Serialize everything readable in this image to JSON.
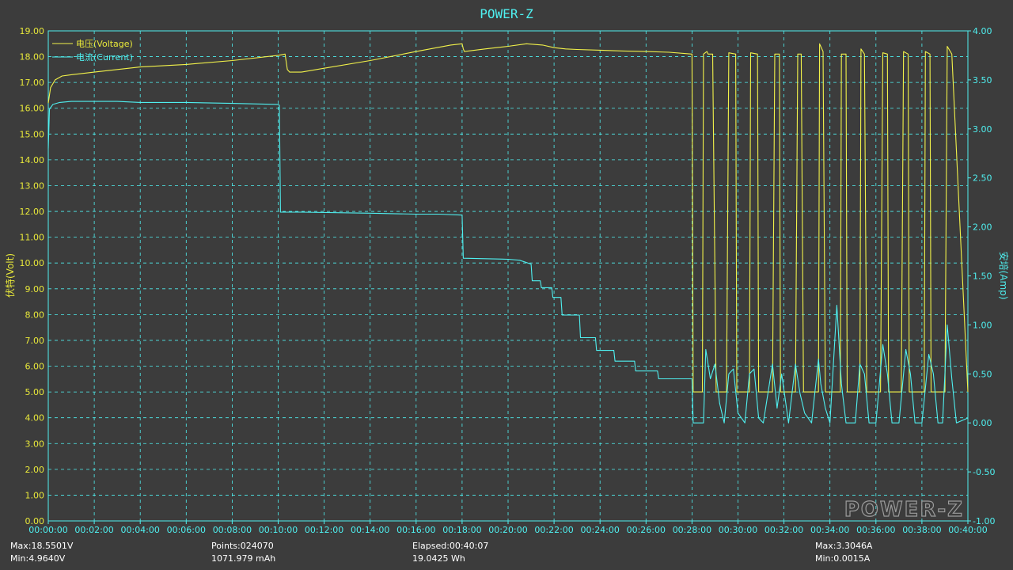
{
  "app": {
    "title": "POWER-Z",
    "logo_text": "POWER-Z"
  },
  "colors": {
    "background": "#3c3c3c",
    "plot_background": "#3c3c3c",
    "grid": "#4ff0f0",
    "voltage": "#f2f24a",
    "current": "#4ff0f0"
  },
  "stats": {
    "max_voltage": "Max:18.5501V",
    "min_voltage": "Min:4.9640V",
    "points": "Points:024070",
    "capacity": "1071.979 mAh",
    "elapsed": "Elapsed:00:40:07",
    "energy": "19.0425 Wh",
    "max_current": "Max:3.3046A",
    "min_current": "Min:0.0015A"
  },
  "chart_data": {
    "type": "line",
    "title": "POWER-Z",
    "x_unit": "elapsed time (minutes)",
    "xlim": [
      0,
      40
    ],
    "x_tick_labels": [
      "00:00:00",
      "00:02:00",
      "00:04:00",
      "00:06:00",
      "00:08:00",
      "00:10:00",
      "00:12:00",
      "00:14:00",
      "00:16:00",
      "00:18:00",
      "00:20:00",
      "00:22:00",
      "00:24:00",
      "00:26:00",
      "00:28:00",
      "00:30:00",
      "00:32:00",
      "00:34:00",
      "00:36:00",
      "00:38:00",
      "00:40:00"
    ],
    "ylabel": "伏特(Volt)",
    "ylim": [
      0,
      19
    ],
    "y_tick_labels": [
      "0.00",
      "1.00",
      "2.00",
      "3.00",
      "4.00",
      "5.00",
      "6.00",
      "7.00",
      "8.00",
      "9.00",
      "10.00",
      "11.00",
      "12.00",
      "13.00",
      "14.00",
      "15.00",
      "16.00",
      "17.00",
      "18.00",
      "19.00"
    ],
    "y2label": "安培(Amp)",
    "y2lim": [
      -1,
      4
    ],
    "y2_tick_labels": [
      "-1.00",
      "-0.50",
      "0.00",
      "0.50",
      "1.00",
      "1.50",
      "2.00",
      "2.50",
      "3.00",
      "3.50",
      "4.00"
    ],
    "grid": true,
    "legend_position": "top-left",
    "series": [
      {
        "name": "电压(Voltage)",
        "axis": "left",
        "x": [
          0,
          0.1,
          0.3,
          0.6,
          1.0,
          2.0,
          4.0,
          6.0,
          8.0,
          10.0,
          10.3,
          10.4,
          10.5,
          11.0,
          12.0,
          14.0,
          16.0,
          17.5,
          18.0,
          18.05,
          18.1,
          19.0,
          20.0,
          20.8,
          21.5,
          22.0,
          22.5,
          23.0,
          24.0,
          25.0,
          26.0,
          27.0,
          28.0,
          28.05,
          28.1,
          28.45,
          28.5,
          28.65,
          28.7,
          28.9,
          29.05,
          29.1,
          29.2,
          29.5,
          29.6,
          29.9,
          29.95,
          30.1,
          30.3,
          30.5,
          30.55,
          30.85,
          30.9,
          31.0,
          31.2,
          31.5,
          31.6,
          31.8,
          31.85,
          32.0,
          32.2,
          32.5,
          32.6,
          32.75,
          32.85,
          33.1,
          33.3,
          33.5,
          33.55,
          33.7,
          33.8,
          34.0,
          34.2,
          34.45,
          34.5,
          34.7,
          34.75,
          34.9,
          35.1,
          35.3,
          35.35,
          35.5,
          35.6,
          35.8,
          36.0,
          36.2,
          36.3,
          36.5,
          36.55,
          36.7,
          36.9,
          37.1,
          37.2,
          37.4,
          37.45,
          37.7,
          37.9,
          38.1,
          38.15,
          38.35,
          38.4,
          38.6,
          38.8,
          39.0,
          39.1,
          39.3,
          40.0
        ],
        "y": [
          16.2,
          16.8,
          17.1,
          17.25,
          17.3,
          17.4,
          17.6,
          17.7,
          17.85,
          18.05,
          18.1,
          17.5,
          17.4,
          17.4,
          17.55,
          17.85,
          18.2,
          18.45,
          18.5,
          18.3,
          18.2,
          18.3,
          18.4,
          18.5,
          18.45,
          18.35,
          18.3,
          18.28,
          18.25,
          18.22,
          18.2,
          18.17,
          18.1,
          5.0,
          5.0,
          5.0,
          18.1,
          18.2,
          18.1,
          18.1,
          5.0,
          5.0,
          5.0,
          5.0,
          18.15,
          18.1,
          5.0,
          5.0,
          5.0,
          5.0,
          18.15,
          18.1,
          5.0,
          5.0,
          5.0,
          5.0,
          18.1,
          18.1,
          5.0,
          5.0,
          5.0,
          5.0,
          18.1,
          18.1,
          5.0,
          5.0,
          5.0,
          5.0,
          18.5,
          18.2,
          5.0,
          5.0,
          5.0,
          5.0,
          18.1,
          18.1,
          5.0,
          5.0,
          5.0,
          5.0,
          18.3,
          18.1,
          5.0,
          5.0,
          5.0,
          5.0,
          18.15,
          18.1,
          5.0,
          5.0,
          5.0,
          5.0,
          18.2,
          18.1,
          5.0,
          5.0,
          5.0,
          5.0,
          18.2,
          18.1,
          5.0,
          5.0,
          5.0,
          5.0,
          18.4,
          18.1,
          5.0
        ]
      },
      {
        "name": "电流(Current)",
        "axis": "right",
        "x": [
          0,
          0.05,
          0.2,
          0.5,
          1.0,
          2.0,
          3.0,
          4.0,
          6.0,
          8.0,
          10.0,
          10.05,
          10.1,
          11.0,
          14.0,
          16.0,
          17.0,
          18.0,
          18.05,
          20.0,
          20.5,
          21.0,
          21.05,
          21.4,
          21.45,
          21.9,
          21.95,
          22.3,
          22.35,
          23.1,
          23.15,
          23.8,
          23.85,
          24.6,
          24.65,
          25.5,
          25.55,
          26.5,
          26.55,
          28.0,
          28.05,
          28.5,
          28.6,
          28.8,
          29.0,
          29.2,
          29.4,
          29.6,
          29.8,
          30.0,
          30.3,
          30.5,
          30.7,
          30.9,
          31.1,
          31.5,
          31.7,
          31.9,
          32.2,
          32.5,
          32.7,
          32.9,
          33.2,
          33.5,
          33.6,
          33.8,
          34.0,
          34.3,
          34.5,
          34.7,
          35.1,
          35.3,
          35.5,
          35.7,
          36.0,
          36.3,
          36.5,
          36.7,
          37.0,
          37.3,
          37.5,
          37.7,
          38.0,
          38.3,
          38.5,
          38.7,
          38.9,
          39.1,
          39.3,
          39.5,
          40.0
        ],
        "y": [
          2.8,
          3.2,
          3.25,
          3.27,
          3.28,
          3.28,
          3.28,
          3.27,
          3.27,
          3.26,
          3.25,
          3.24,
          2.15,
          2.15,
          2.14,
          2.13,
          2.13,
          2.12,
          1.68,
          1.67,
          1.66,
          1.62,
          1.45,
          1.45,
          1.38,
          1.38,
          1.28,
          1.28,
          1.1,
          1.1,
          0.87,
          0.87,
          0.74,
          0.74,
          0.63,
          0.63,
          0.53,
          0.53,
          0.45,
          0.45,
          0.0,
          0.0,
          0.75,
          0.45,
          0.6,
          0.2,
          0.0,
          0.5,
          0.55,
          0.1,
          0.0,
          0.5,
          0.55,
          0.05,
          0.0,
          0.6,
          0.15,
          0.5,
          0.0,
          0.6,
          0.3,
          0.1,
          0.0,
          0.65,
          0.4,
          0.15,
          0.0,
          1.2,
          0.4,
          0.0,
          0.0,
          0.6,
          0.5,
          0.0,
          0.0,
          0.8,
          0.5,
          0.0,
          0.0,
          0.75,
          0.5,
          0.0,
          0.0,
          0.7,
          0.5,
          0.0,
          0.0,
          1.0,
          0.45,
          0.0,
          0.05
        ]
      }
    ]
  }
}
